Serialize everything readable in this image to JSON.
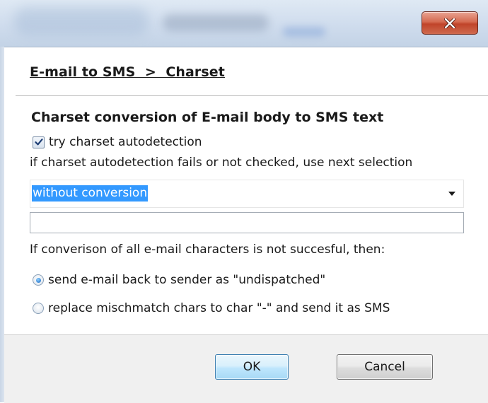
{
  "window": {
    "close_label": "X"
  },
  "breadcrumb": {
    "text": "E-mail to SMS  >  Charset"
  },
  "section": {
    "title": "Charset conversion of E-mail body to SMS text",
    "autodetect_label": "try charset autodetection",
    "autodetect_checked": true,
    "fallback_info": "if charset autodetection fails or not checked, use next selection",
    "charset_selected": "without conversion",
    "custom_charset_value": "",
    "condition_text": "If converison of all e-mail characters is not succesful, then:",
    "options": [
      {
        "label": "send e-mail back to sender as \"undispatched\"",
        "selected": true
      },
      {
        "label": "replace mischmatch chars to char \"-\" and send it as SMS",
        "selected": false
      }
    ]
  },
  "footer": {
    "ok_label": "OK",
    "cancel_label": "Cancel"
  },
  "colors": {
    "selection_highlight": "#3399ff",
    "close_button": "#c0442a",
    "default_button_border": "#3c7fb1"
  }
}
